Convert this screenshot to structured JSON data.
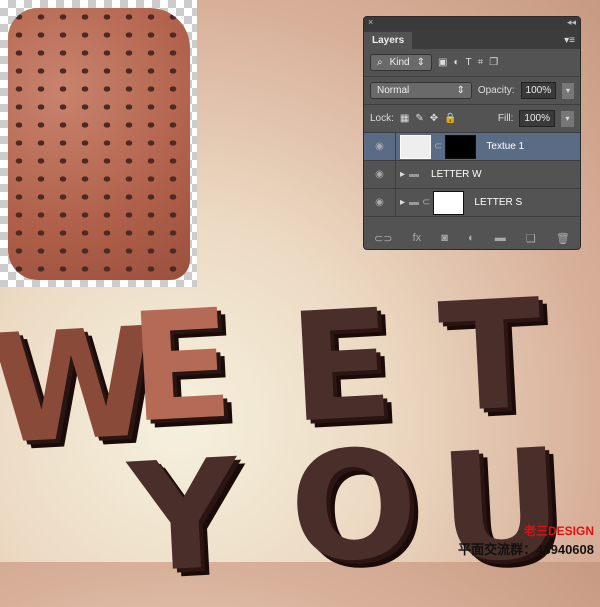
{
  "canvas": {
    "letters_row1": [
      "W",
      "E",
      "E",
      "T"
    ],
    "letters_row2": [
      "Y",
      "O",
      "U"
    ]
  },
  "panel": {
    "close": "×",
    "collapse": "◂◂",
    "tab": "Layers",
    "menu": "▾≡",
    "filter": {
      "label": "Kind",
      "icon": "search-icon"
    },
    "filter_icons": [
      "▣",
      "◐",
      "T",
      "⌗",
      "❐"
    ],
    "blend_mode": "Normal",
    "opacity_label": "Opacity:",
    "opacity": "100%",
    "lock_label": "Lock:",
    "lock_icons": [
      "▦",
      "✎",
      "✥",
      "🔒"
    ],
    "fill_label": "Fill:",
    "fill": "100%",
    "layers": [
      {
        "name": "Textue 1",
        "selected": true
      },
      {
        "name": "LETTER W",
        "selected": false
      },
      {
        "name": "LETTER S",
        "selected": false
      }
    ],
    "footer_icons": [
      "⊂⊃",
      "fx",
      "◙",
      "◐",
      "▬",
      "❏",
      "🗑"
    ]
  },
  "watermark": {
    "brand": "老三DESIGN",
    "group": "平面交流群：43940608"
  },
  "colors": {
    "selected_layer": "#5a6b85",
    "brand": "#e01010"
  }
}
